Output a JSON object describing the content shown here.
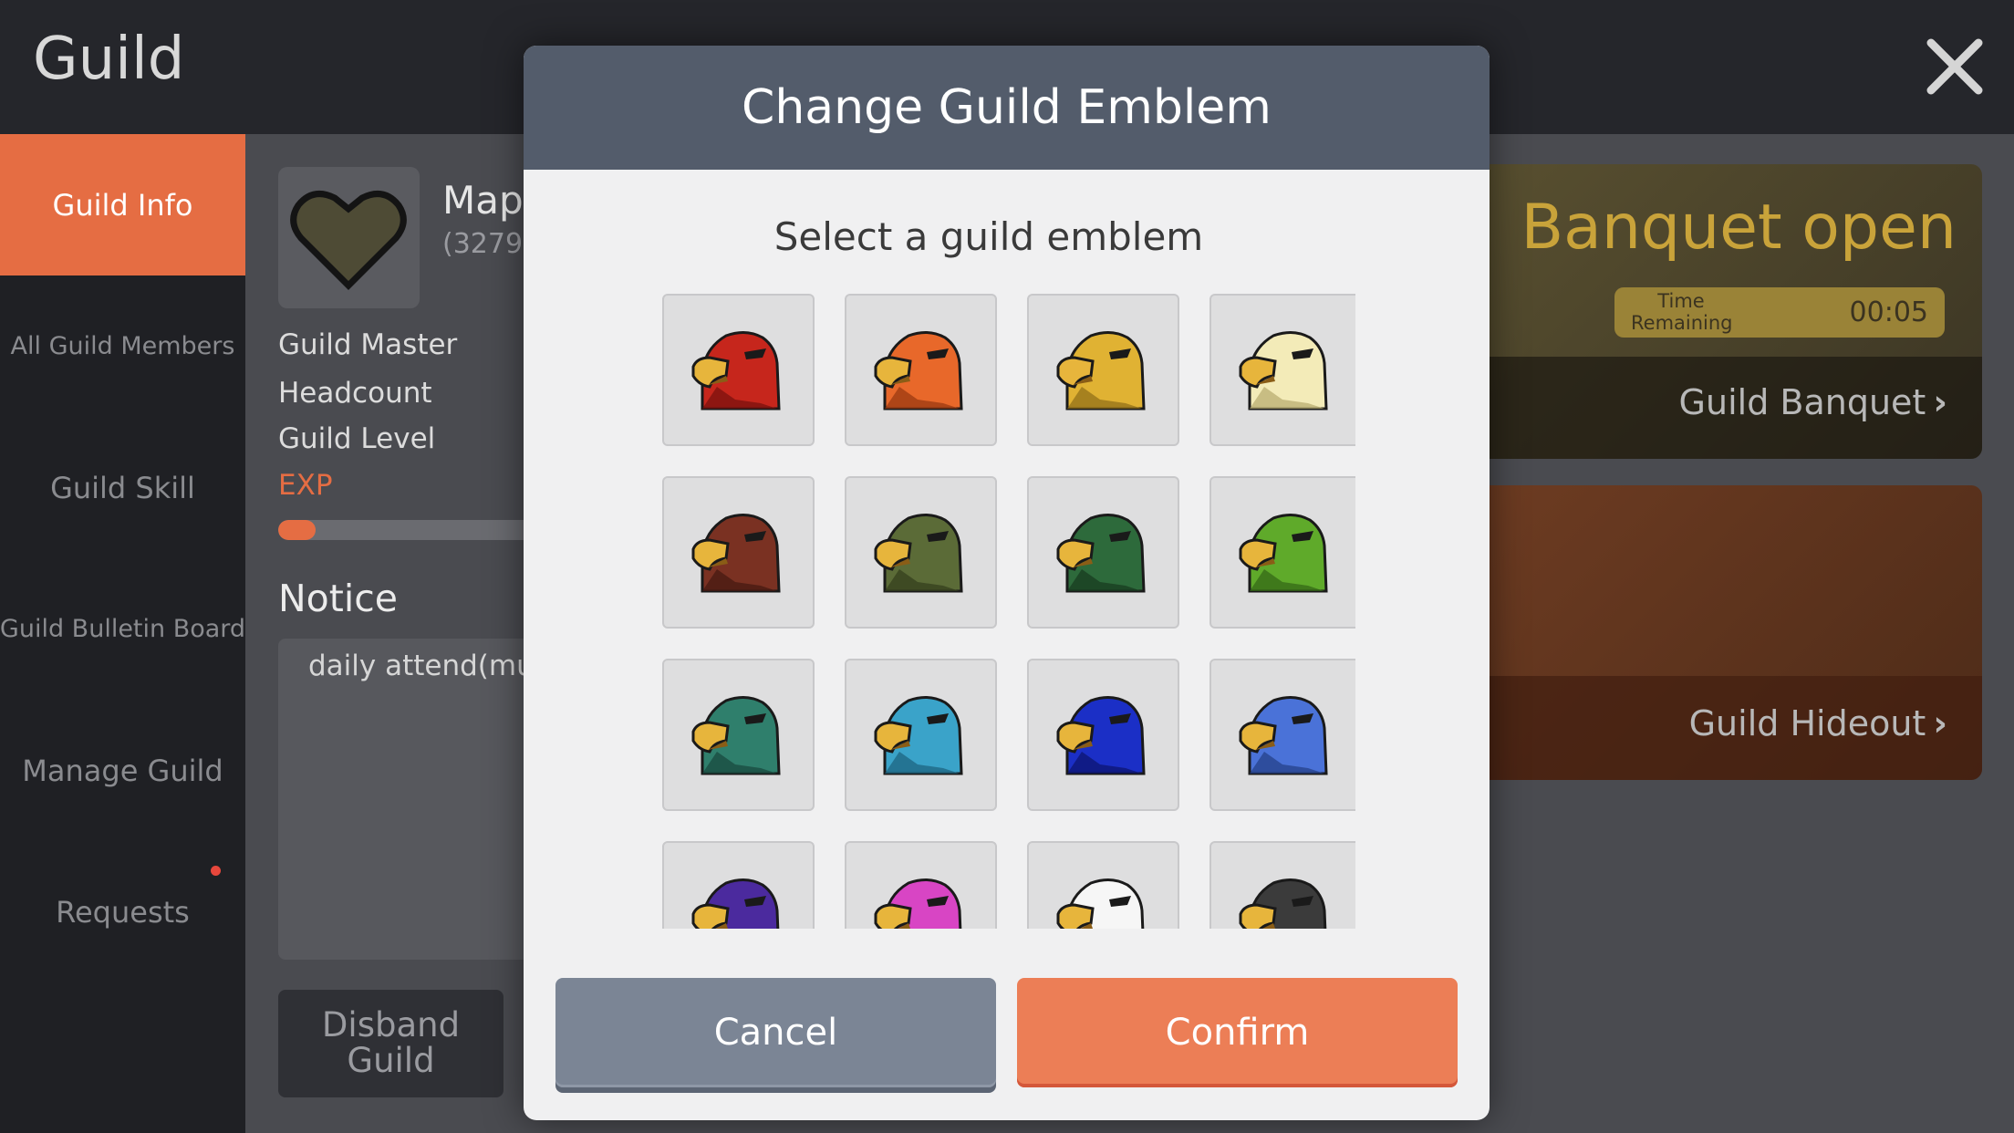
{
  "app": {
    "title": "Guild"
  },
  "sidebar": {
    "items": [
      {
        "label": "Guild Info",
        "active": true
      },
      {
        "label": "All Guild Members"
      },
      {
        "label": "Guild Skill"
      },
      {
        "label": "Guild Bulletin Board"
      },
      {
        "label": "Manage Guild"
      },
      {
        "label": "Requests",
        "has_notification": true
      }
    ]
  },
  "guild": {
    "name_partial": "Map",
    "id_partial": "(3279)",
    "labels": [
      "Guild Master",
      "Headcount",
      "Guild Level",
      "EXP"
    ],
    "exp_fraction": 0.14,
    "notice_title": "Notice",
    "notice_text": "daily attend(mu",
    "disband_label": "Disband Guild"
  },
  "banquet": {
    "title": "Banquet open",
    "time_label": "Time Remaining",
    "time_value": "00:05",
    "link_label": "Guild Banquet"
  },
  "hideout": {
    "link_label": "Guild Hideout"
  },
  "modal": {
    "title": "Change Guild Emblem",
    "subtitle": "Select a guild emblem",
    "cancel_label": "Cancel",
    "confirm_label": "Confirm",
    "emblems": [
      {
        "icon": "red-eagle-icon",
        "color": "#c6261c",
        "dark": "#7a120d"
      },
      {
        "icon": "orange-eagle-icon",
        "color": "#e8682a",
        "dark": "#9b3a12"
      },
      {
        "icon": "gold-eagle-icon",
        "color": "#e0b233",
        "dark": "#93701a"
      },
      {
        "icon": "cream-eagle-icon",
        "color": "#f3ebb8",
        "dark": "#b9ad72"
      },
      {
        "icon": "brown-eagle-icon",
        "color": "#7a3122",
        "dark": "#471a12"
      },
      {
        "icon": "olive-eagle-icon",
        "color": "#5b6b37",
        "dark": "#343f1e"
      },
      {
        "icon": "dark-green-eagle-icon",
        "color": "#2d6a3b",
        "dark": "#183c20"
      },
      {
        "icon": "lime-eagle-icon",
        "color": "#5faa2a",
        "dark": "#346817"
      },
      {
        "icon": "teal-eagle-icon",
        "color": "#2f7f6c",
        "dark": "#1a4a3f"
      },
      {
        "icon": "sky-eagle-icon",
        "color": "#3aa3c9",
        "dark": "#1d6480"
      },
      {
        "icon": "blue-eagle-icon",
        "color": "#1b2fc6",
        "dark": "#0d1670"
      },
      {
        "icon": "periwinkle-eagle-icon",
        "color": "#4a72d8",
        "dark": "#26418a"
      },
      {
        "icon": "purple-eagle-icon",
        "color": "#4b2a9e",
        "dark": "#2a165c"
      },
      {
        "icon": "pink-eagle-icon",
        "color": "#d845c4",
        "dark": "#852877"
      },
      {
        "icon": "white-eagle-icon",
        "color": "#f6f6f6",
        "dark": "#a9a9a9"
      },
      {
        "icon": "black-eagle-icon",
        "color": "#3b3b3b",
        "dark": "#1a1a1a"
      }
    ]
  }
}
